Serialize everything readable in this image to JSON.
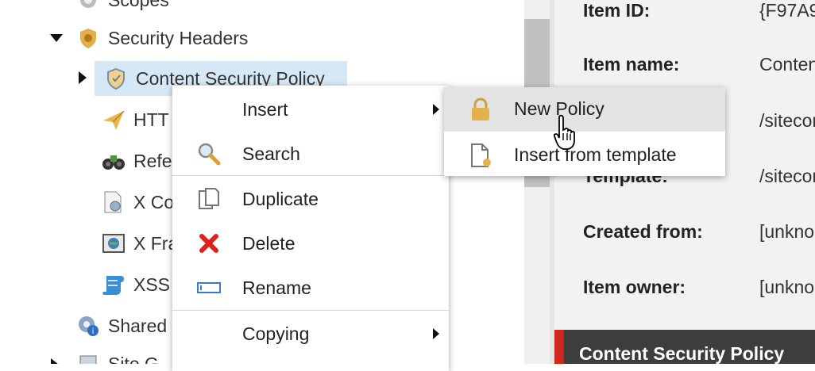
{
  "tree": {
    "items": [
      {
        "label": "Scopes",
        "icon": "scopes-icon"
      },
      {
        "label": "Security Headers",
        "icon": "security-headers-icon",
        "expanded": true
      },
      {
        "label": "Content Security Policy",
        "icon": "shield-icon",
        "selected": true
      },
      {
        "label": "HTT",
        "icon": "paper-plane-icon"
      },
      {
        "label": "Refe",
        "icon": "binoculars-icon"
      },
      {
        "label": "X Co",
        "icon": "document-gear-icon"
      },
      {
        "label": "X Fra",
        "icon": "frame-icon"
      },
      {
        "label": "XSS",
        "icon": "scroll-icon"
      },
      {
        "label": "Shared",
        "icon": "shared-gear-icon"
      },
      {
        "label": "Site G",
        "icon": "site-icon"
      }
    ]
  },
  "details": {
    "rows": [
      {
        "key": "Item ID:",
        "value": "{F97A9"
      },
      {
        "key": "Item name:",
        "value": "Conten"
      },
      {
        "key": "",
        "value": "/sitecor"
      },
      {
        "key": "Template:",
        "value": "/sitecor"
      },
      {
        "key": "Created from:",
        "value": "[unkno"
      },
      {
        "key": "Item owner:",
        "value": "[unkno"
      }
    ],
    "footer_title": "Content Security Policy"
  },
  "context_menu": {
    "items": [
      {
        "label": "Insert",
        "icon": "",
        "has_submenu": true
      },
      {
        "label": "Search",
        "icon": "magnifier-icon"
      },
      {
        "label": "Duplicate",
        "icon": "duplicate-icon"
      },
      {
        "label": "Delete",
        "icon": "delete-x-icon"
      },
      {
        "label": "Rename",
        "icon": "rename-icon"
      },
      {
        "label": "Copying",
        "icon": "",
        "has_submenu": true
      }
    ]
  },
  "submenu": {
    "items": [
      {
        "label": "New Policy",
        "icon": "lock-icon",
        "hover": true
      },
      {
        "label": "Insert from template",
        "icon": "template-icon"
      }
    ]
  },
  "colors": {
    "selected_bg": "#d6e8f5",
    "footer_bg": "#3d3d3d",
    "footer_accent": "#d0281e",
    "delete_red": "#e0201b",
    "gold": "#d9a52c"
  }
}
